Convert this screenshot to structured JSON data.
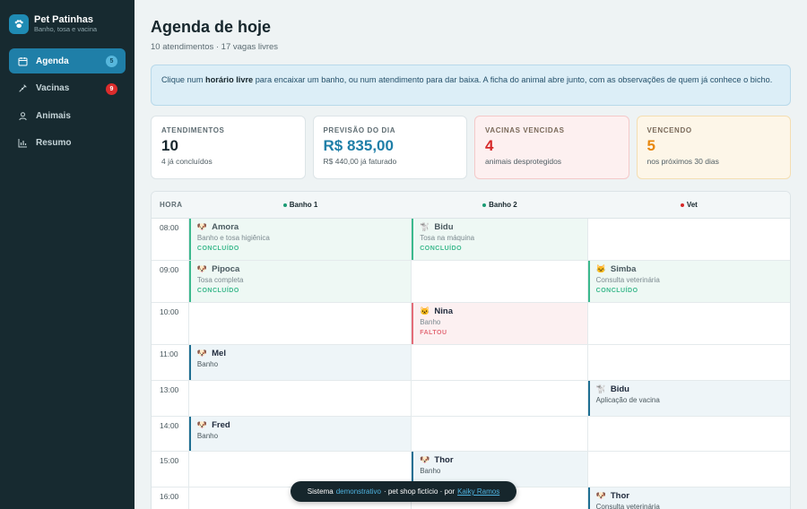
{
  "brand": {
    "name": "Pet Patinhas",
    "subtitle": "Banho, tosa e vacina",
    "logo_icon": "paw-icon"
  },
  "nav": {
    "items": [
      {
        "label": "Agenda",
        "icon": "calendar-icon",
        "badge": "5",
        "active": true
      },
      {
        "label": "Vacinas",
        "icon": "syringe-icon",
        "badge": "9",
        "active": false
      },
      {
        "label": "Animais",
        "icon": "user-icon",
        "badge": "",
        "active": false
      },
      {
        "label": "Resumo",
        "icon": "chart-icon",
        "badge": "",
        "active": false
      }
    ]
  },
  "header": {
    "title": "Agenda de hoje",
    "subtitle": "10 atendimentos · 17 vagas livres"
  },
  "info": {
    "before": "Clique num ",
    "bold": "horário livre",
    "after": " para encaixar um banho, ou num atendimento para dar baixa. A ficha do animal abre junto, com as observações de quem já conhece o bicho."
  },
  "stats": [
    {
      "label": "ATENDIMENTOS",
      "value": "10",
      "note": "4 já concluídos",
      "tone": "neutral"
    },
    {
      "label": "PREVISÃO DO DIA",
      "value": "R$ 835,00",
      "note": "R$ 440,00 já faturado",
      "tone": "blue"
    },
    {
      "label": "VACINAS VENCIDAS",
      "value": "4",
      "note": "animais desprotegidos",
      "tone": "red"
    },
    {
      "label": "VENCENDO",
      "value": "5",
      "note": "nos próximos 30 dias",
      "tone": "amber"
    }
  ],
  "schedule": {
    "hora_label": "HORA",
    "columns": [
      {
        "label": "Banho 1",
        "dot_color": "#1a9b74"
      },
      {
        "label": "Banho 2",
        "dot_color": "#1a9b74"
      },
      {
        "label": "Vet",
        "dot_color": "#d62828"
      }
    ],
    "rows": [
      {
        "time": "08:00",
        "height": 47,
        "cells": [
          {
            "pet": "Amora",
            "icon": "dog-icon",
            "service": "Banho e tosa higiênica",
            "status": "CONCLUÍDO",
            "state": "done"
          },
          {
            "pet": "Bidu",
            "icon": "poodle-icon",
            "service": "Tosa na máquina",
            "status": "CONCLUÍDO",
            "state": "done"
          },
          null
        ]
      },
      {
        "time": "09:00",
        "height": 47,
        "cells": [
          {
            "pet": "Pipoca",
            "icon": "dog-icon",
            "service": "Tosa completa",
            "status": "CONCLUÍDO",
            "state": "done"
          },
          null,
          {
            "pet": "Simba",
            "icon": "cat-icon",
            "service": "Consulta veterinária",
            "status": "CONCLUÍDO",
            "state": "done"
          }
        ]
      },
      {
        "time": "10:00",
        "height": 47,
        "cells": [
          null,
          {
            "pet": "Nina",
            "icon": "cat-icon",
            "service": "Banho",
            "status": "FALTOU",
            "state": "miss"
          },
          null
        ]
      },
      {
        "time": "11:00",
        "height": 40,
        "cells": [
          {
            "pet": "Mel",
            "icon": "dog-icon",
            "service": "Banho",
            "status": "",
            "state": "open"
          },
          null,
          null
        ]
      },
      {
        "time": "13:00",
        "height": 40,
        "cells": [
          null,
          null,
          {
            "pet": "Bidu",
            "icon": "poodle-icon",
            "service": "Aplicação de vacina",
            "status": "",
            "state": "open"
          }
        ]
      },
      {
        "time": "14:00",
        "height": 39,
        "cells": [
          {
            "pet": "Fred",
            "icon": "dog-icon",
            "service": "Banho",
            "status": "",
            "state": "open"
          },
          null,
          null
        ]
      },
      {
        "time": "15:00",
        "height": 40,
        "cells": [
          null,
          {
            "pet": "Thor",
            "icon": "dog-icon",
            "service": "Banho",
            "status": "",
            "state": "open"
          },
          null
        ]
      },
      {
        "time": "16:00",
        "height": 40,
        "cells": [
          null,
          null,
          {
            "pet": "Thor",
            "icon": "dog-icon",
            "service": "Consulta veterinária",
            "status": "",
            "state": "open"
          }
        ]
      }
    ]
  },
  "toast": {
    "prefix": "Sistema",
    "highlight": "demonstrativo",
    "middle": "· pet shop fictício · por",
    "link": "Kaiky Ramos"
  }
}
